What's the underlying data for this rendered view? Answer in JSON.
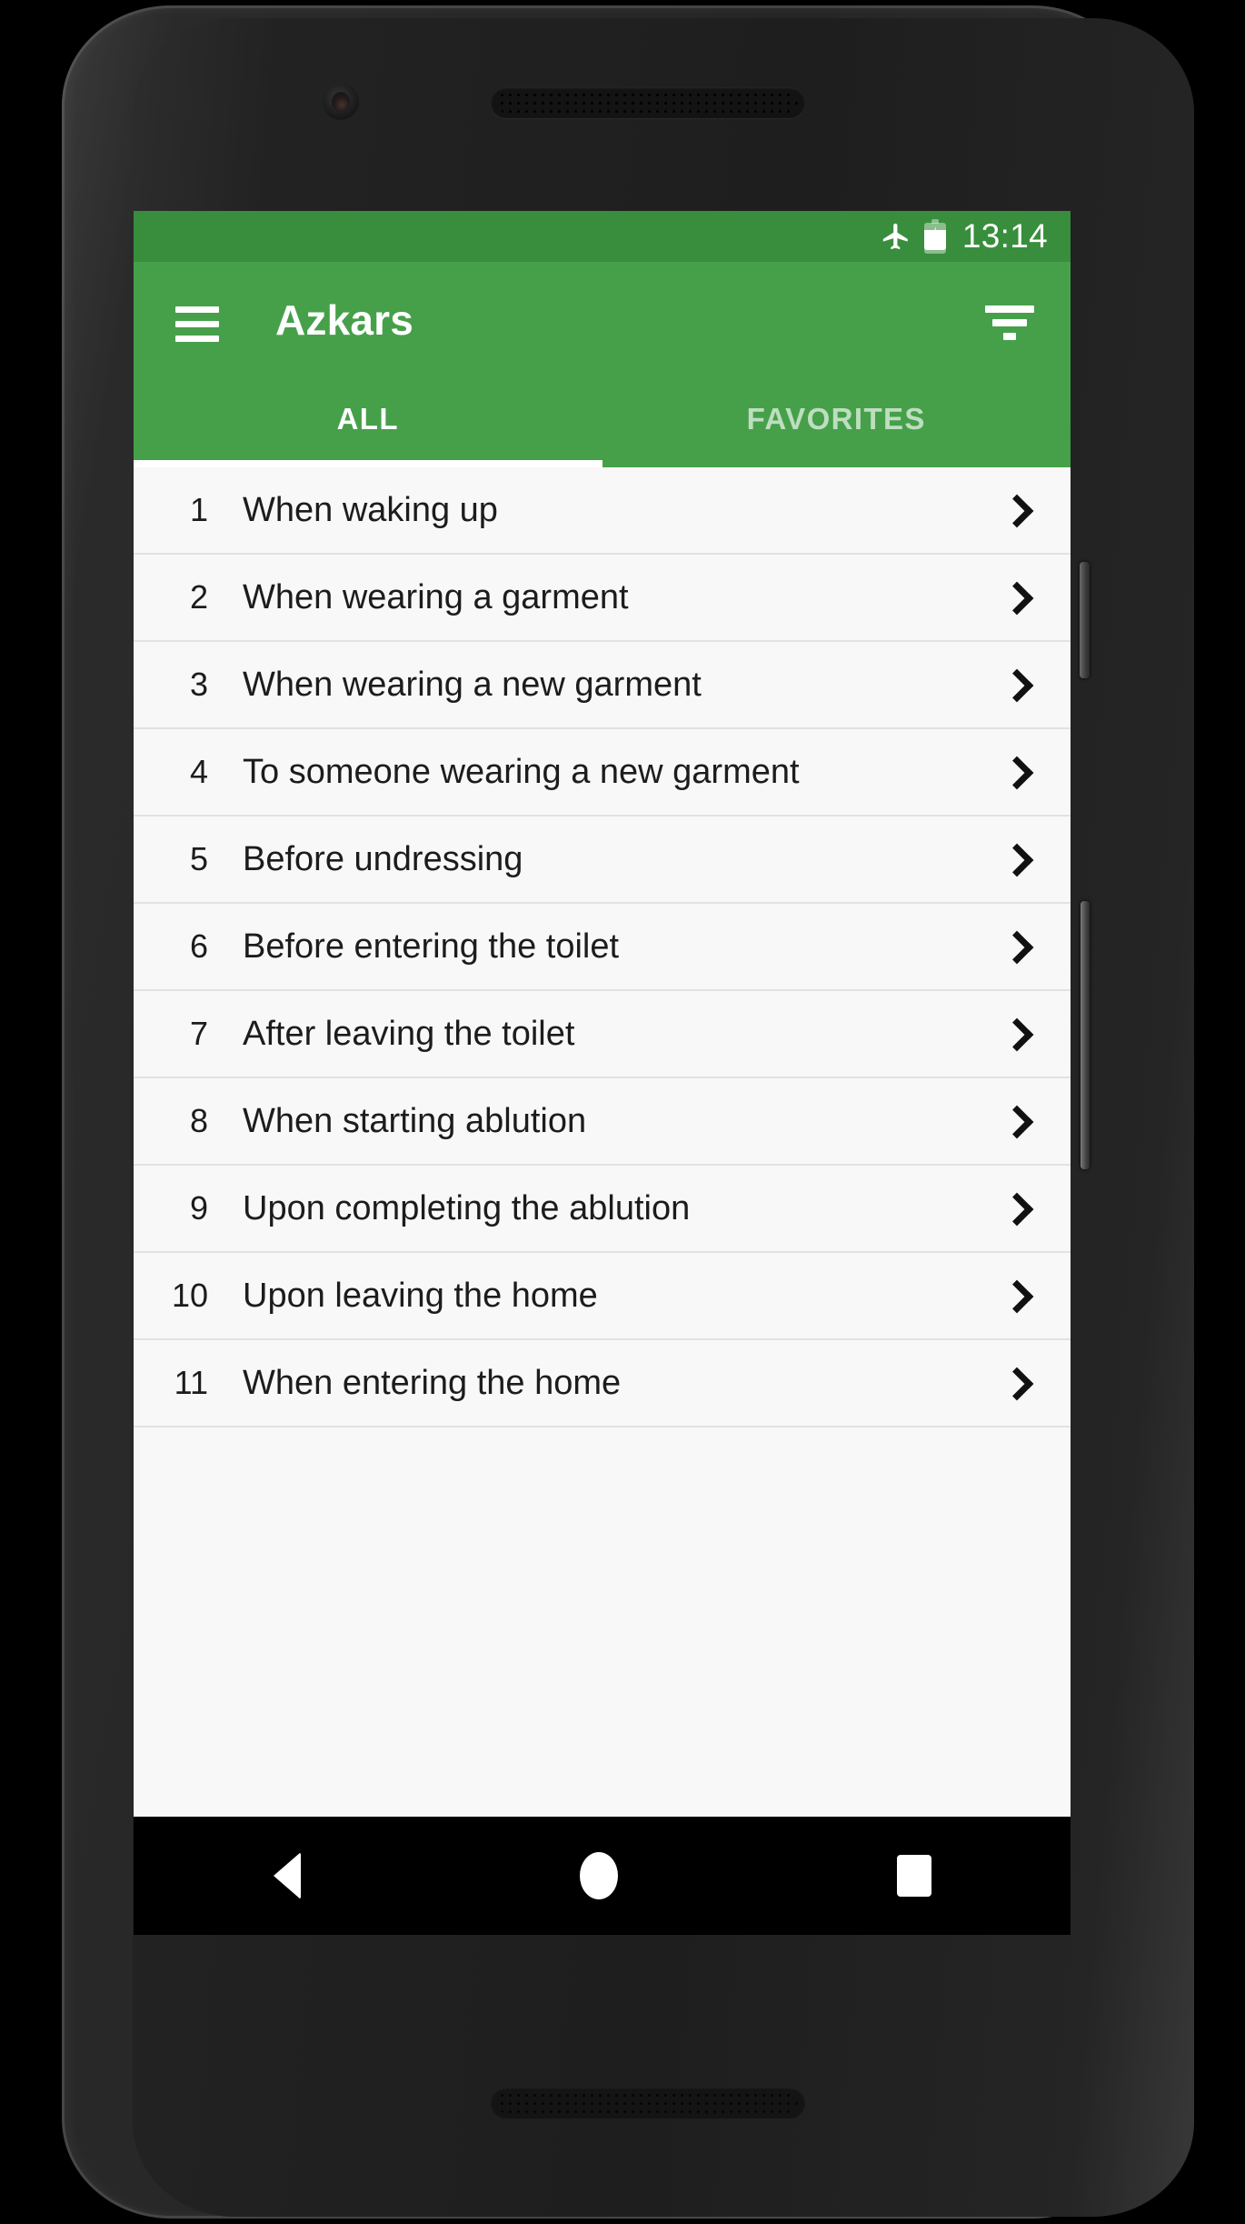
{
  "status_bar": {
    "airplane_icon": "airplane-mode-icon",
    "battery_icon": "battery-charging-icon",
    "time": "13:14"
  },
  "app_bar": {
    "menu_icon": "hamburger-menu-icon",
    "title": "Azkars",
    "filter_icon": "filter-sort-icon"
  },
  "tabs": [
    {
      "label": "ALL",
      "active": true
    },
    {
      "label": "FAVORITES",
      "active": false
    }
  ],
  "list": {
    "items": [
      {
        "number": "1",
        "title": "When waking up"
      },
      {
        "number": "2",
        "title": "When wearing a garment"
      },
      {
        "number": "3",
        "title": "When wearing a new garment"
      },
      {
        "number": "4",
        "title": "To someone wearing a new garment"
      },
      {
        "number": "5",
        "title": "Before undressing"
      },
      {
        "number": "6",
        "title": "Before entering the toilet"
      },
      {
        "number": "7",
        "title": "After leaving the toilet"
      },
      {
        "number": "8",
        "title": "When starting ablution"
      },
      {
        "number": "9",
        "title": "Upon completing the ablution"
      },
      {
        "number": "10",
        "title": "Upon leaving the home"
      },
      {
        "number": "11",
        "title": "When entering the home"
      }
    ],
    "chevron_icon": "chevron-right-icon"
  },
  "nav_bar": {
    "back_icon": "back-triangle-icon",
    "home_icon": "home-circle-icon",
    "recents_icon": "recents-square-icon"
  },
  "colors": {
    "status_bar_green": "#388e3c",
    "app_bar_green": "#46a04a",
    "list_background": "#f8f8f8",
    "divider": "#e2e2e2",
    "text": "#1c1c1c",
    "nav_bar": "#000000"
  }
}
